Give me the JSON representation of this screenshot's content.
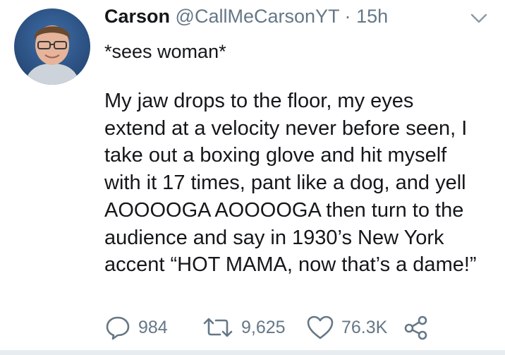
{
  "tweet": {
    "author_name": "Carson",
    "handle": "@CallMeCarsonYT",
    "separator": "·",
    "time": "15h",
    "action_line": "*sees woman*",
    "body_lines": [
      "My jaw drops to the floor, my eyes",
      "extend at a velocity never before seen, I",
      "take out a boxing glove and hit myself",
      "with it 17 times, pant like a dog, and yell",
      "AOOOOGA AOOOOGA then turn to the",
      "audience and say in 1930’s New York",
      "accent “HOT MAMA, now that’s a dame!”"
    ],
    "reply_count": "984",
    "retweet_count": "9,625",
    "like_count": "76.3K"
  },
  "icons": {
    "menu": "chevron-down-icon",
    "reply": "reply-icon",
    "retweet": "retweet-icon",
    "like": "heart-icon",
    "share": "share-icon"
  },
  "colors": {
    "text": "#14171a",
    "secondary": "#657786",
    "divider": "#e6ecf0"
  }
}
